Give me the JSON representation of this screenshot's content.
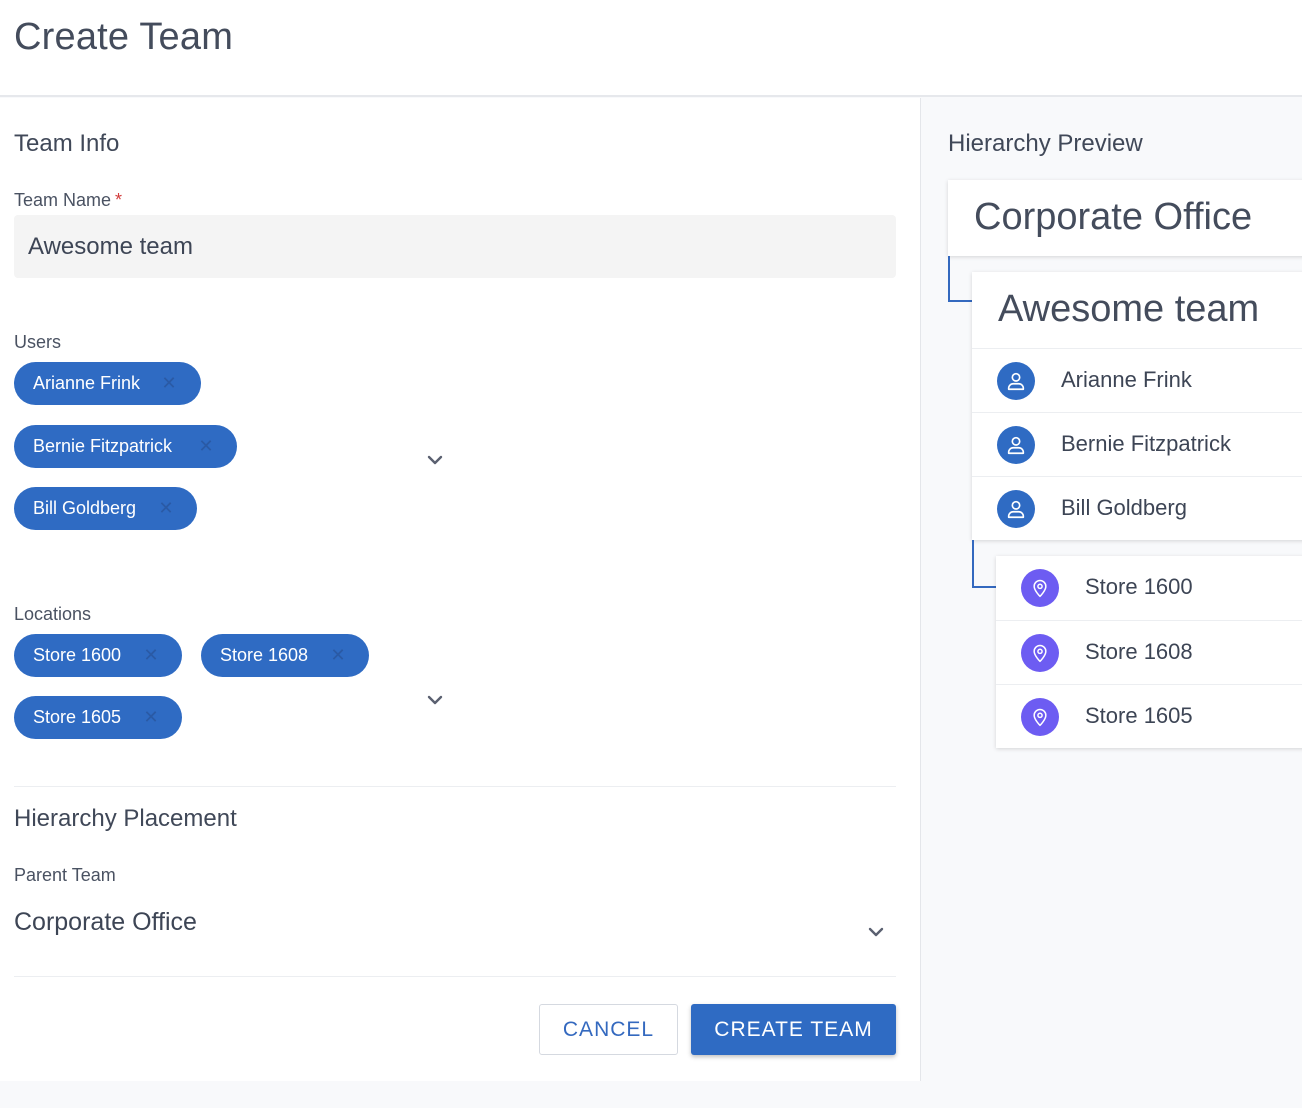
{
  "header": {
    "title": "Create Team"
  },
  "team_info": {
    "title": "Team Info",
    "team_name_label": "Team Name",
    "required_marker": "*",
    "team_name_value": "Awesome team"
  },
  "users": {
    "label": "Users",
    "chips": [
      "Arianne Frink",
      "Bernie Fitzpatrick",
      "Bill Goldberg"
    ]
  },
  "locations": {
    "label": "Locations",
    "chips": [
      "Store 1600",
      "Store 1608",
      "Store 1605"
    ]
  },
  "placement": {
    "title": "Hierarchy Placement",
    "parent_label": "Parent Team",
    "parent_value": "Corporate Office"
  },
  "actions": {
    "cancel": "CANCEL",
    "create": "CREATE TEAM"
  },
  "preview": {
    "title": "Hierarchy Preview",
    "parent": "Corporate Office",
    "team": "Awesome team",
    "users": [
      "Arianne Frink",
      "Bernie Fitzpatrick",
      "Bill Goldberg"
    ],
    "locations": [
      "Store 1600",
      "Store 1608",
      "Store 1605"
    ]
  },
  "icons": {
    "chip_remove": "close-icon",
    "dropdown": "chevron-down-icon",
    "user": "user-icon",
    "location": "location-pin-icon"
  },
  "colors": {
    "primary": "#2f6bc3",
    "location_icon": "#6d5cf2",
    "required": "#d23b3b",
    "connector": "#3469bf"
  }
}
